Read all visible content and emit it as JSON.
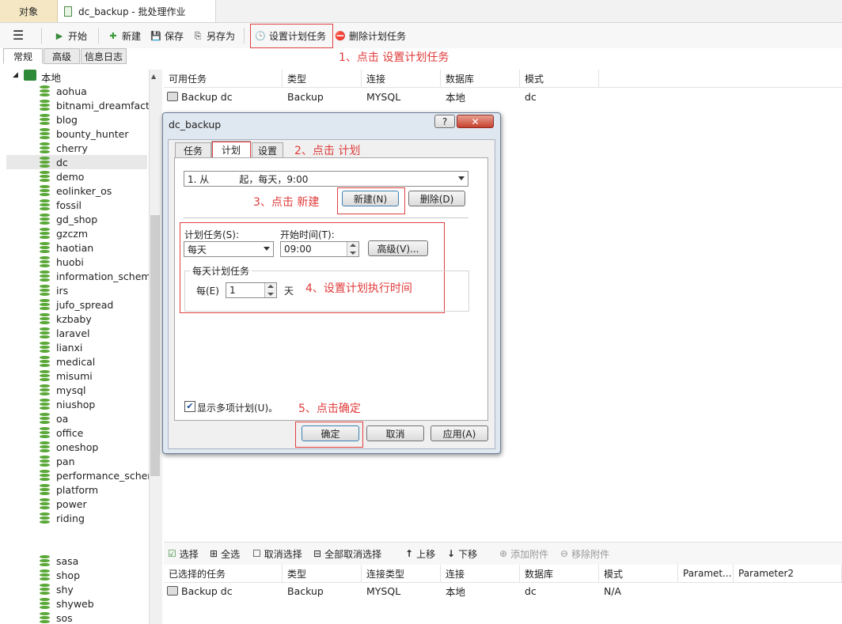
{
  "tabs": {
    "object": "对象",
    "job": "dc_backup - 批处理作业"
  },
  "toolbar": {
    "start": "开始",
    "new": "新建",
    "save": "保存",
    "save_as": "另存为",
    "set_schedule": "设置计划任务",
    "delete_schedule": "删除计划任务"
  },
  "left_tabs": {
    "general": "常规",
    "advanced": "高级",
    "log": "信息日志"
  },
  "tree": {
    "root": "本地",
    "items": [
      "aohua",
      "bitnami_dreamfacto",
      "blog",
      "bounty_hunter",
      "cherry",
      "dc",
      "demo",
      "eolinker_os",
      "fossil",
      "gd_shop",
      "gzczm",
      "haotian",
      "huobi",
      "information_schema",
      "irs",
      "jufo_spread",
      "kzbaby",
      "laravel",
      "lianxi",
      "medical",
      "misumi",
      "mysql",
      "niushop",
      "oa",
      "office",
      "oneshop",
      "pan",
      "performance_schem",
      "platform",
      "power",
      "riding",
      "",
      "",
      "sasa",
      "shop",
      "shy",
      "shyweb",
      "sos"
    ],
    "selected": "dc"
  },
  "available": {
    "headers": [
      "可用任务",
      "类型",
      "连接",
      "数据库",
      "模式"
    ],
    "rows": [
      [
        "Backup dc",
        "Backup",
        "MYSQL",
        "本地",
        "dc"
      ]
    ]
  },
  "bottom_toolbar": {
    "select": "选择",
    "select_all": "全选",
    "deselect": "取消选择",
    "deselect_all": "全部取消选择",
    "move_up": "上移",
    "move_down": "下移",
    "add_attach": "添加附件",
    "remove_attach": "移除附件"
  },
  "selected_tasks": {
    "headers": [
      "已选择的任务",
      "类型",
      "连接类型",
      "连接",
      "数据库",
      "模式",
      "Paramet...",
      "Parameter2"
    ],
    "rows": [
      [
        "Backup dc",
        "Backup",
        "MYSQL",
        "本地",
        "dc",
        "N/A",
        "",
        ""
      ]
    ]
  },
  "dialog": {
    "title": "dc_backup",
    "help": "?",
    "tabs": {
      "task": "任务",
      "plan": "计划",
      "settings": "设置"
    },
    "schedule_combo": "1. 从          起，每天，9:00",
    "new_btn": "新建(N)",
    "delete_btn": "删除(D)",
    "plan_task_label": "计划任务(S):",
    "plan_task_value": "每天",
    "start_time_label": "开始时间(T):",
    "start_time_value": "09:00",
    "advanced_btn": "高级(V)...",
    "daily_group": "每天计划任务",
    "every_label": "每(E)",
    "every_value": "1",
    "day_unit": "天",
    "multi_checkbox": "显示多项计划(U)。",
    "ok": "确定",
    "cancel": "取消",
    "apply": "应用(A)"
  },
  "annotations": {
    "a1": "1、点击 设置计划任务",
    "a2": "2、点击 计划",
    "a3": "3、点击 新建",
    "a4": "4、设置计划执行时间",
    "a5": "5、点击确定"
  },
  "colors": {
    "annotation": "#e03a3a",
    "db_icon": "#5aa838",
    "object_tab": "#f5e7c4"
  }
}
